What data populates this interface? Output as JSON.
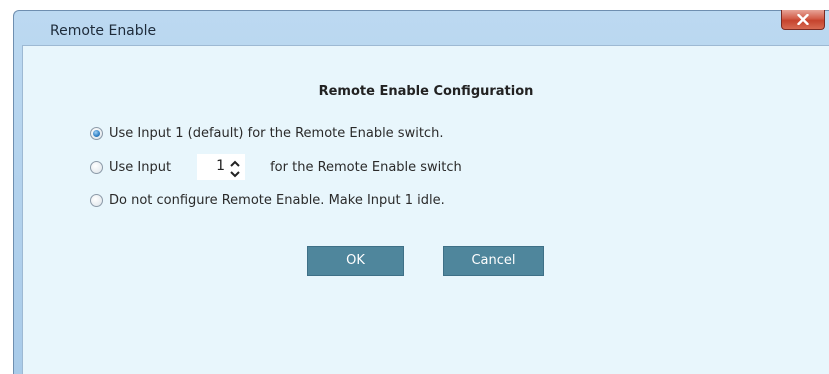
{
  "window": {
    "title": "Remote Enable",
    "close_icon": "close-icon"
  },
  "dialog": {
    "heading": "Remote Enable Configuration",
    "options": [
      {
        "label": "Use Input 1 (default) for the Remote Enable switch.",
        "checked": true
      },
      {
        "label_before": "Use Input",
        "input_value": "1",
        "label_after": "for the Remote Enable switch",
        "checked": false
      },
      {
        "label": "Do not configure Remote Enable. Make Input 1 idle.",
        "checked": false
      }
    ],
    "ok_label": "OK",
    "cancel_label": "Cancel"
  },
  "colors": {
    "client_background": "#e8f6fc",
    "button_background": "#4f869c",
    "title_bar": "#bcd9f1",
    "close_button": "#c6432d"
  }
}
